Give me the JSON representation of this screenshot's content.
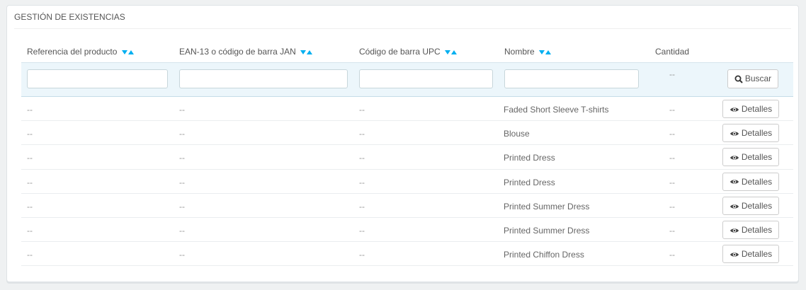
{
  "panel": {
    "title": "GESTIÓN DE EXISTENCIAS"
  },
  "table": {
    "headers": {
      "reference": "Referencia del producto",
      "ean": "EAN-13 o código de barra JAN",
      "upc": "Código de barra UPC",
      "name": "Nombre",
      "quantity": "Cantidad"
    },
    "filter": {
      "quantity_dash": "--",
      "search_label": "Buscar"
    },
    "rows": [
      {
        "reference": "--",
        "ean": "--",
        "upc": "--",
        "name": "Faded Short Sleeve T-shirts",
        "quantity": "--",
        "action": "Detalles"
      },
      {
        "reference": "--",
        "ean": "--",
        "upc": "--",
        "name": "Blouse",
        "quantity": "--",
        "action": "Detalles"
      },
      {
        "reference": "--",
        "ean": "--",
        "upc": "--",
        "name": "Printed Dress",
        "quantity": "--",
        "action": "Detalles"
      },
      {
        "reference": "--",
        "ean": "--",
        "upc": "--",
        "name": "Printed Dress",
        "quantity": "--",
        "action": "Detalles"
      },
      {
        "reference": "--",
        "ean": "--",
        "upc": "--",
        "name": "Printed Summer Dress",
        "quantity": "--",
        "action": "Detalles"
      },
      {
        "reference": "--",
        "ean": "--",
        "upc": "--",
        "name": "Printed Summer Dress",
        "quantity": "--",
        "action": "Detalles"
      },
      {
        "reference": "--",
        "ean": "--",
        "upc": "--",
        "name": "Printed Chiffon Dress",
        "quantity": "--",
        "action": "Detalles"
      }
    ]
  },
  "icons": {
    "sort_desc": "caret-down-icon",
    "sort_asc": "caret-up-icon",
    "search": "search-icon",
    "details": "eye-icon"
  },
  "colors": {
    "accent": "#00aff0",
    "filter_bg": "#ecf6fb"
  }
}
